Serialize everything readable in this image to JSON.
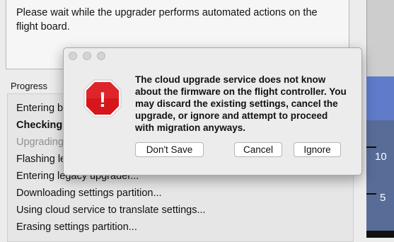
{
  "upgrader": {
    "instruction": "Please wait while the upgrader performs automated actions on the flight board.",
    "progress_label": "Progress",
    "steps": [
      {
        "label": "Entering bo",
        "state": "done"
      },
      {
        "label": "Checking",
        "state": "active"
      },
      {
        "label": "Upgrading",
        "state": "pending"
      },
      {
        "label": "Flashing le",
        "state": "done"
      },
      {
        "label": "Entering legacy upgrader...",
        "state": "done"
      },
      {
        "label": "Downloading settings partition...",
        "state": "done"
      },
      {
        "label": "Using cloud service to translate settings...",
        "state": "done"
      },
      {
        "label": "Erasing settings partition...",
        "state": "done"
      }
    ]
  },
  "side_scale": {
    "labels": [
      "10",
      "5"
    ]
  },
  "dialog": {
    "icon": "stop-alert-icon",
    "icon_glyph": "!",
    "message": "The cloud upgrade service does not know about the firmware on the flight controller. You may discard the existing settings, cancel the upgrade, or ignore and attempt to proceed with migration anyways.",
    "buttons": {
      "dont_save": "Don't Save",
      "cancel": "Cancel",
      "ignore": "Ignore"
    }
  },
  "colors": {
    "alert_red": "#d6161b",
    "scale_blue": "#5f7bc9",
    "scale_dark_blue": "#586c98"
  }
}
